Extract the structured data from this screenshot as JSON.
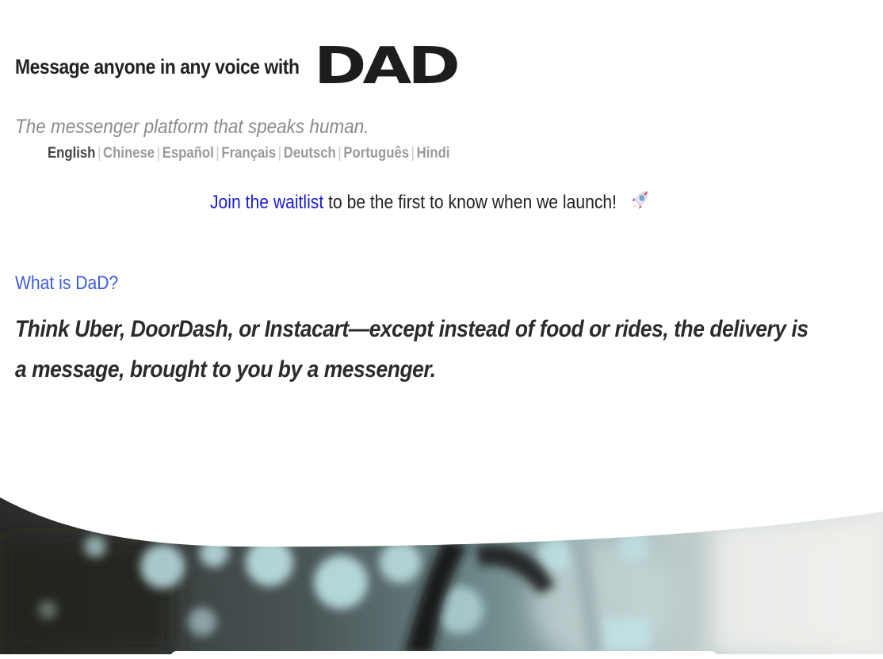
{
  "header": {
    "headline": "Message anyone in any voice with",
    "logo_text": "DAD"
  },
  "tagline": "The messenger platform that speaks human.",
  "languages": {
    "items": [
      "English",
      "Chinese",
      "Español",
      "Français",
      "Deutsch",
      "Português",
      "Hindi"
    ],
    "active": "English"
  },
  "waitlist": {
    "link_text": "Join the waitlist",
    "rest_text": " to be the first to know when we launch!",
    "icon": "rocket-icon"
  },
  "about": {
    "title": "What is DaD?",
    "body": " Think Uber, DoorDash, or Instacart—except instead of food or rides, the delivery is a message, brought to you by a messenger."
  },
  "hero": {
    "image": "blurred-bokeh-photo"
  },
  "colors": {
    "link": "#1b1bcf",
    "section_title": "#3b5bdb",
    "muted": "#9a9a9a"
  }
}
